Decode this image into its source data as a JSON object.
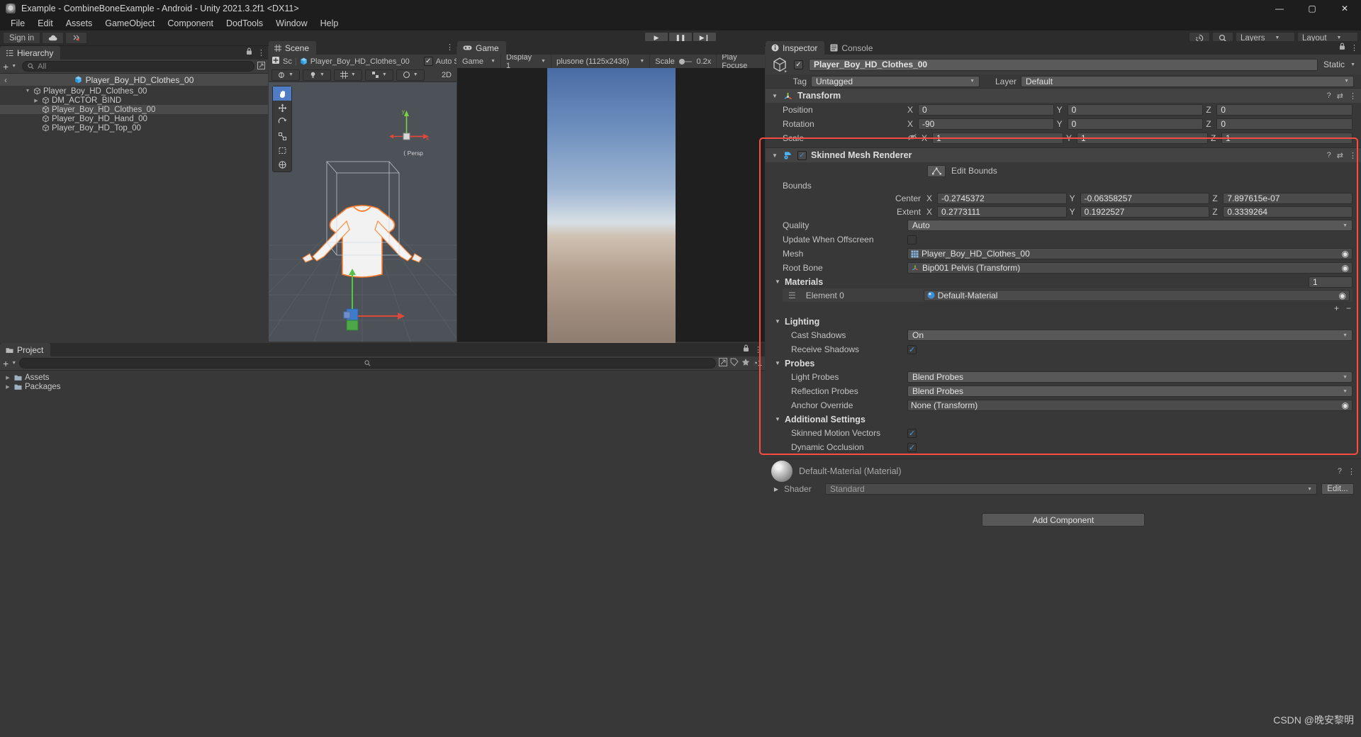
{
  "window": {
    "title": "Example - CombineBoneExample - Android - Unity 2021.3.2f1 <DX11>",
    "minimize": "—",
    "maximize": "▢",
    "close": "✕"
  },
  "menu": [
    "File",
    "Edit",
    "Assets",
    "GameObject",
    "Component",
    "DodTools",
    "Window",
    "Help"
  ],
  "toolbar": {
    "sign_in": "Sign in",
    "cloud_icon": "cloud-icon",
    "account_icon": "account-icon",
    "play": "▶",
    "pause": "❚❚",
    "step": "▶❙",
    "history_icon": "history-icon",
    "search_icon": "search-icon",
    "layers": "Layers",
    "layout": "Layout"
  },
  "hierarchy": {
    "tab": "Hierarchy",
    "tab_icon": "hierarchy-icon",
    "add": "+",
    "search_placeholder": "All",
    "breadcrumb": "Player_Boy_HD_Clothes_00",
    "items": [
      {
        "label": "Player_Boy_HD_Clothes_00",
        "indent": 0,
        "twist": "▼",
        "selected": false
      },
      {
        "label": "DM_ACTOR_BIND",
        "indent": 1,
        "twist": "▶",
        "selected": false
      },
      {
        "label": "Player_Boy_HD_Clothes_00",
        "indent": 1,
        "twist": "",
        "selected": true
      },
      {
        "label": "Player_Boy_HD_Hand_00",
        "indent": 1,
        "twist": "",
        "selected": false
      },
      {
        "label": "Player_Boy_HD_Top_00",
        "indent": 1,
        "twist": "",
        "selected": false
      }
    ]
  },
  "scene": {
    "tab": "Scene",
    "tab_icon": "scene-grid-icon",
    "shading": "Sc",
    "object": "Player_Boy_HD_Clothes_00",
    "auto_save": "Auto Sav",
    "two_d": "2D",
    "persp_label": "Persp",
    "axis_x": "x",
    "axis_y": "y",
    "tools": [
      "hand-tool",
      "move-tool",
      "rotate-tool",
      "scale-tool",
      "rect-tool",
      "transform-tool"
    ]
  },
  "game": {
    "tab": "Game",
    "tab_icon": "gamepad-icon",
    "mode": "Game",
    "display": "Display 1",
    "resolution": "plusone (1125x2436)",
    "scale_label": "Scale",
    "scale_value": "0.2x",
    "play_focused": "Play Focuse"
  },
  "project": {
    "tab": "Project",
    "tab_icon": "project-icon",
    "add": "+",
    "search_placeholder": "",
    "items": [
      {
        "label": "Assets",
        "twist": "▶"
      },
      {
        "label": "Packages",
        "twist": "▶"
      }
    ]
  },
  "inspector": {
    "tabs": [
      {
        "label": "Inspector",
        "icon": "info-icon",
        "active": true
      },
      {
        "label": "Console",
        "icon": "console-icon",
        "active": false
      }
    ],
    "object_name": "Player_Boy_HD_Clothes_00",
    "static_label": "Static",
    "tag_label": "Tag",
    "tag_value": "Untagged",
    "layer_label": "Layer",
    "layer_value": "Default",
    "transform": {
      "title": "Transform",
      "icon": "transform-axis-icon",
      "rows": [
        {
          "label": "Position",
          "x": "0",
          "y": "0",
          "z": "0"
        },
        {
          "label": "Rotation",
          "x": "-90",
          "y": "0",
          "z": "0"
        },
        {
          "label": "Scale",
          "x": "1",
          "y": "1",
          "z": "1",
          "link_icon": "scale-link-off-icon"
        }
      ]
    },
    "skinned_mesh_renderer": {
      "title": "Skinned Mesh Renderer",
      "icon": "skinned-mesh-renderer-icon",
      "enabled": true,
      "edit_bounds": "Edit Bounds",
      "edit_bounds_icon": "edit-bounds-icon",
      "bounds_label": "Bounds",
      "center_label": "Center",
      "center": {
        "x": "-0.2745372",
        "y": "-0.06358257",
        "z": "7.897615e-07"
      },
      "extent_label": "Extent",
      "extent": {
        "x": "0.2773111",
        "y": "0.1922527",
        "z": "0.3339264"
      },
      "quality_label": "Quality",
      "quality_value": "Auto",
      "update_offscreen_label": "Update When Offscreen",
      "update_offscreen_checked": false,
      "mesh_label": "Mesh",
      "mesh_value": "Player_Boy_HD_Clothes_00",
      "root_bone_label": "Root Bone",
      "root_bone_value": "Bip001 Pelvis (Transform)",
      "materials_label": "Materials",
      "materials_count": "1",
      "material_element_label": "Element 0",
      "material_element_value": "Default-Material",
      "add_element": "+",
      "remove_element": "−",
      "lighting_label": "Lighting",
      "cast_shadows_label": "Cast Shadows",
      "cast_shadows_value": "On",
      "receive_shadows_label": "Receive Shadows",
      "receive_shadows_checked": true,
      "probes_label": "Probes",
      "light_probes_label": "Light Probes",
      "light_probes_value": "Blend Probes",
      "reflection_probes_label": "Reflection Probes",
      "reflection_probes_value": "Blend Probes",
      "anchor_override_label": "Anchor Override",
      "anchor_override_value": "None (Transform)",
      "additional_settings_label": "Additional Settings",
      "skinned_motion_vectors_label": "Skinned Motion Vectors",
      "skinned_motion_vectors_checked": true,
      "dynamic_occlusion_label": "Dynamic Occlusion",
      "dynamic_occlusion_checked": true
    },
    "material_preview": {
      "title": "Default-Material (Material)",
      "shader_label": "Shader",
      "shader_value": "Standard",
      "edit_button": "Edit..."
    },
    "add_component": "Add Component"
  },
  "watermark": "CSDN @晚安黎明",
  "colors": {
    "accent_red": "#fd4b42",
    "selection": "#4a4a4a",
    "panel_bg": "#383838",
    "header_bg": "#3c3c3c"
  }
}
